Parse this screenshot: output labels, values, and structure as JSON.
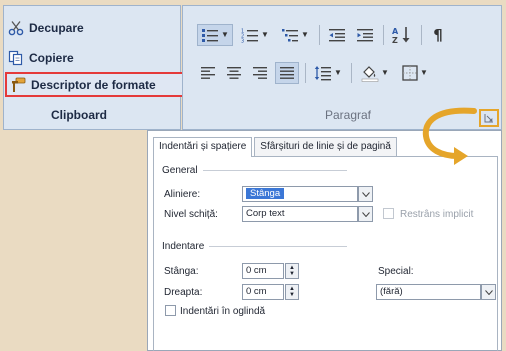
{
  "clipboard": {
    "cut_label": "Decupare",
    "copy_label": "Copiere",
    "format_painter_label": "Descriptor de formate",
    "group_label": "Clipboard"
  },
  "paragraph": {
    "group_label": "Paragraf",
    "pilcrow": "¶"
  },
  "dialog": {
    "tabs": [
      "Indentări și spațiere",
      "Sfârșituri de linie și de pagină"
    ],
    "general": {
      "section_label": "General",
      "alignment_label": "Aliniere:",
      "alignment_value": "Stânga",
      "outline_label": "Nivel schiță:",
      "outline_value": "Corp text",
      "collapsed_label": "Restrâns implicit"
    },
    "indent": {
      "section_label": "Indentare",
      "left_label": "Stânga:",
      "left_value": "0 cm",
      "right_label": "Dreapta:",
      "right_value": "0 cm",
      "special_label": "Special:",
      "special_value": "(fără)",
      "mirror_label": "Indentări în oglindă"
    }
  },
  "colors": {
    "highlight_box": "#e53a3a",
    "launcher_box": "#e5a52a",
    "arrow": "#e5a52a",
    "ribbon_bg": "#dce6f2",
    "selection": "#3b77d6"
  }
}
